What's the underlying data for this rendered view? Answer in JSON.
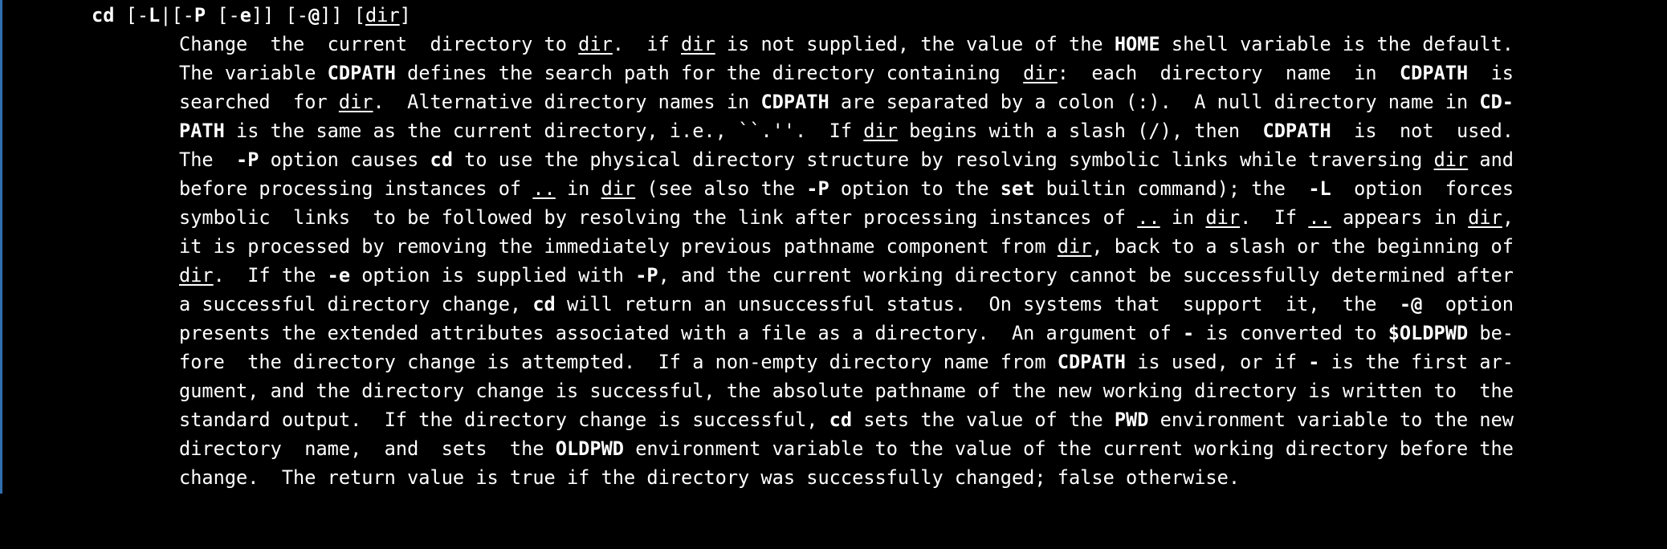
{
  "colors": {
    "background": "#000000",
    "text": "#ffffff",
    "frame": "#2f6fb0"
  },
  "manpage": {
    "synopsis": [
      {
        "t": "cd",
        "s": "b"
      },
      {
        "t": " [-"
      },
      {
        "t": "L",
        "s": "b"
      },
      {
        "t": "|[-"
      },
      {
        "t": "P",
        "s": "b"
      },
      {
        "t": " [-"
      },
      {
        "t": "e",
        "s": "b"
      },
      {
        "t": "]] [-"
      },
      {
        "t": "@",
        "s": "b"
      },
      {
        "t": "]] ["
      },
      {
        "t": "dir",
        "s": "u"
      },
      {
        "t": "]"
      }
    ],
    "lines": [
      [
        {
          "t": "Change  the  current  directory to "
        },
        {
          "t": "dir",
          "s": "u"
        },
        {
          "t": ".  if "
        },
        {
          "t": "dir",
          "s": "u"
        },
        {
          "t": " is not supplied, the value of the "
        },
        {
          "t": "HOME",
          "s": "b"
        },
        {
          "t": " shell variable is the default."
        }
      ],
      [
        {
          "t": "The variable "
        },
        {
          "t": "CDPATH",
          "s": "b"
        },
        {
          "t": " defines the search path for the directory containing  "
        },
        {
          "t": "dir",
          "s": "u"
        },
        {
          "t": ":  each  directory  name  in  "
        },
        {
          "t": "CDPATH",
          "s": "b"
        },
        {
          "t": "  is"
        }
      ],
      [
        {
          "t": "searched  for "
        },
        {
          "t": "dir",
          "s": "u"
        },
        {
          "t": ".  Alternative directory names in "
        },
        {
          "t": "CDPATH",
          "s": "b"
        },
        {
          "t": " are separated by a colon (:).  A null directory name in "
        },
        {
          "t": "CD-",
          "s": "b"
        }
      ],
      [
        {
          "t": "PATH",
          "s": "b"
        },
        {
          "t": " is the same as the current directory, i.e., ``.''.  If "
        },
        {
          "t": "dir",
          "s": "u"
        },
        {
          "t": " begins with a slash (/), then  "
        },
        {
          "t": "CDPATH",
          "s": "b"
        },
        {
          "t": "  is  not  used."
        }
      ],
      [
        {
          "t": "The  "
        },
        {
          "t": "-P",
          "s": "b"
        },
        {
          "t": " option causes "
        },
        {
          "t": "cd",
          "s": "b"
        },
        {
          "t": " to use the physical directory structure by resolving symbolic links while traversing "
        },
        {
          "t": "dir",
          "s": "u"
        },
        {
          "t": " and"
        }
      ],
      [
        {
          "t": "before processing instances of "
        },
        {
          "t": "..",
          "s": "u"
        },
        {
          "t": " in "
        },
        {
          "t": "dir",
          "s": "u"
        },
        {
          "t": " (see also the "
        },
        {
          "t": "-P",
          "s": "b"
        },
        {
          "t": " option to the "
        },
        {
          "t": "set",
          "s": "b"
        },
        {
          "t": " builtin command); the  "
        },
        {
          "t": "-L",
          "s": "b"
        },
        {
          "t": "  option  forces"
        }
      ],
      [
        {
          "t": "symbolic  links  to be followed by resolving the link after processing instances of "
        },
        {
          "t": "..",
          "s": "u"
        },
        {
          "t": " in "
        },
        {
          "t": "dir",
          "s": "u"
        },
        {
          "t": ".  If "
        },
        {
          "t": "..",
          "s": "u"
        },
        {
          "t": " appears in "
        },
        {
          "t": "dir",
          "s": "u"
        },
        {
          "t": ","
        }
      ],
      [
        {
          "t": "it is processed by removing the immediately previous pathname component from "
        },
        {
          "t": "dir",
          "s": "u"
        },
        {
          "t": ", back to a slash or the beginning of"
        }
      ],
      [
        {
          "t": "dir",
          "s": "u"
        },
        {
          "t": ".  If the "
        },
        {
          "t": "-e",
          "s": "b"
        },
        {
          "t": " option is supplied with "
        },
        {
          "t": "-P",
          "s": "b"
        },
        {
          "t": ", and the current working directory cannot be successfully determined after"
        }
      ],
      [
        {
          "t": "a successful directory change, "
        },
        {
          "t": "cd",
          "s": "b"
        },
        {
          "t": " will return an unsuccessful status.  On systems that  support  it,  the  "
        },
        {
          "t": "-@",
          "s": "b"
        },
        {
          "t": "  option"
        }
      ],
      [
        {
          "t": "presents the extended attributes associated with a file as a directory.  An argument of "
        },
        {
          "t": "-",
          "s": "b"
        },
        {
          "t": " is converted to "
        },
        {
          "t": "$OLDPWD",
          "s": "b"
        },
        {
          "t": " be-"
        }
      ],
      [
        {
          "t": "fore  the directory change is attempted.  If a non-empty directory name from "
        },
        {
          "t": "CDPATH",
          "s": "b"
        },
        {
          "t": " is used, or if "
        },
        {
          "t": "-",
          "s": "b"
        },
        {
          "t": " is the first ar-"
        }
      ],
      [
        {
          "t": "gument, and the directory change is successful, the absolute pathname of the new working directory is written to  the"
        }
      ],
      [
        {
          "t": "standard output.  If the directory change is successful, "
        },
        {
          "t": "cd",
          "s": "b"
        },
        {
          "t": " sets the value of the "
        },
        {
          "t": "PWD",
          "s": "b"
        },
        {
          "t": " environment variable to the new"
        }
      ],
      [
        {
          "t": "directory  name,  and  sets  the "
        },
        {
          "t": "OLDPWD",
          "s": "b"
        },
        {
          "t": " environment variable to the value of the current working directory before the"
        }
      ],
      [
        {
          "t": "change.  The return value is true if the directory was successfully changed; false otherwise."
        }
      ]
    ]
  }
}
